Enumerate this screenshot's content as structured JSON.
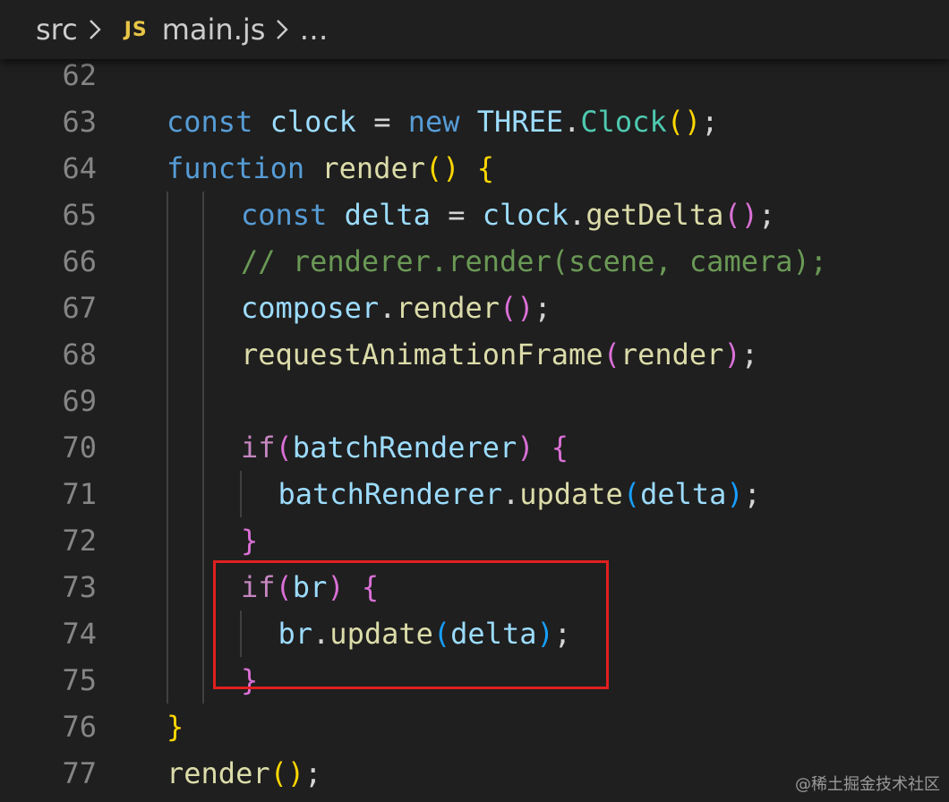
{
  "breadcrumb": {
    "folder": "src",
    "file_icon": "JS",
    "file": "main.js",
    "trail": "…"
  },
  "colors": {
    "background": "#1f1f1f",
    "keyword": "#569cd6",
    "variable": "#9cdcfe",
    "class": "#4ec9b0",
    "function": "#dcdcaa",
    "comment": "#6a9955",
    "control": "#c586c0",
    "highlight_box": "#e0201f"
  },
  "lines": [
    {
      "n": "62",
      "tokens": []
    },
    {
      "n": "63",
      "tokens": [
        {
          "t": "const",
          "c": "kw"
        },
        {
          "t": " ",
          "c": ""
        },
        {
          "t": "clock",
          "c": "var"
        },
        {
          "t": " = ",
          "c": ""
        },
        {
          "t": "new",
          "c": "kw"
        },
        {
          "t": " ",
          "c": ""
        },
        {
          "t": "THREE",
          "c": "var"
        },
        {
          "t": ".",
          "c": ""
        },
        {
          "t": "Clock",
          "c": "cls"
        },
        {
          "t": "()",
          "c": "p1"
        },
        {
          "t": ";",
          "c": ""
        }
      ]
    },
    {
      "n": "64",
      "tokens": [
        {
          "t": "function",
          "c": "kw"
        },
        {
          "t": " ",
          "c": ""
        },
        {
          "t": "render",
          "c": "fn"
        },
        {
          "t": "()",
          "c": "p1"
        },
        {
          "t": " ",
          "c": ""
        },
        {
          "t": "{",
          "c": "p1"
        }
      ]
    },
    {
      "n": "65",
      "tokens": [
        {
          "t": "const",
          "c": "kw"
        },
        {
          "t": " ",
          "c": ""
        },
        {
          "t": "delta",
          "c": "var"
        },
        {
          "t": " = ",
          "c": ""
        },
        {
          "t": "clock",
          "c": "var"
        },
        {
          "t": ".",
          "c": ""
        },
        {
          "t": "getDelta",
          "c": "fn"
        },
        {
          "t": "()",
          "c": "p2"
        },
        {
          "t": ";",
          "c": ""
        }
      ]
    },
    {
      "n": "66",
      "tokens": [
        {
          "t": "// renderer.render(scene, camera);",
          "c": "cmt"
        }
      ]
    },
    {
      "n": "67",
      "tokens": [
        {
          "t": "composer",
          "c": "var"
        },
        {
          "t": ".",
          "c": ""
        },
        {
          "t": "render",
          "c": "fn"
        },
        {
          "t": "()",
          "c": "p2"
        },
        {
          "t": ";",
          "c": ""
        }
      ]
    },
    {
      "n": "68",
      "tokens": [
        {
          "t": "requestAnimationFrame",
          "c": "fn"
        },
        {
          "t": "(",
          "c": "p2"
        },
        {
          "t": "render",
          "c": "fn"
        },
        {
          "t": ")",
          "c": "p2"
        },
        {
          "t": ";",
          "c": ""
        }
      ]
    },
    {
      "n": "69",
      "tokens": []
    },
    {
      "n": "70",
      "tokens": [
        {
          "t": "if",
          "c": "ctl"
        },
        {
          "t": "(",
          "c": "p2"
        },
        {
          "t": "batchRenderer",
          "c": "var"
        },
        {
          "t": ")",
          "c": "p2"
        },
        {
          "t": " ",
          "c": ""
        },
        {
          "t": "{",
          "c": "p2"
        }
      ]
    },
    {
      "n": "71",
      "tokens": [
        {
          "t": "batchRenderer",
          "c": "var"
        },
        {
          "t": ".",
          "c": ""
        },
        {
          "t": "update",
          "c": "fn"
        },
        {
          "t": "(",
          "c": "p3"
        },
        {
          "t": "delta",
          "c": "var"
        },
        {
          "t": ")",
          "c": "p3"
        },
        {
          "t": ";",
          "c": ""
        }
      ]
    },
    {
      "n": "72",
      "tokens": [
        {
          "t": "}",
          "c": "p2"
        }
      ]
    },
    {
      "n": "73",
      "tokens": [
        {
          "t": "if",
          "c": "ctl"
        },
        {
          "t": "(",
          "c": "p2"
        },
        {
          "t": "br",
          "c": "var"
        },
        {
          "t": ")",
          "c": "p2"
        },
        {
          "t": " ",
          "c": ""
        },
        {
          "t": "{",
          "c": "p2"
        }
      ]
    },
    {
      "n": "74",
      "tokens": [
        {
          "t": "br",
          "c": "var"
        },
        {
          "t": ".",
          "c": ""
        },
        {
          "t": "update",
          "c": "fn"
        },
        {
          "t": "(",
          "c": "p3"
        },
        {
          "t": "delta",
          "c": "var"
        },
        {
          "t": ")",
          "c": "p3"
        },
        {
          "t": ";",
          "c": ""
        }
      ]
    },
    {
      "n": "75",
      "tokens": [
        {
          "t": "}",
          "c": "p2"
        }
      ]
    },
    {
      "n": "76",
      "tokens": [
        {
          "t": "}",
          "c": "p1"
        }
      ]
    },
    {
      "n": "77",
      "tokens": [
        {
          "t": "render",
          "c": "fn"
        },
        {
          "t": "()",
          "c": "p1"
        },
        {
          "t": ";",
          "c": ""
        }
      ]
    }
  ],
  "watermark": "@稀土掘金技术社区"
}
